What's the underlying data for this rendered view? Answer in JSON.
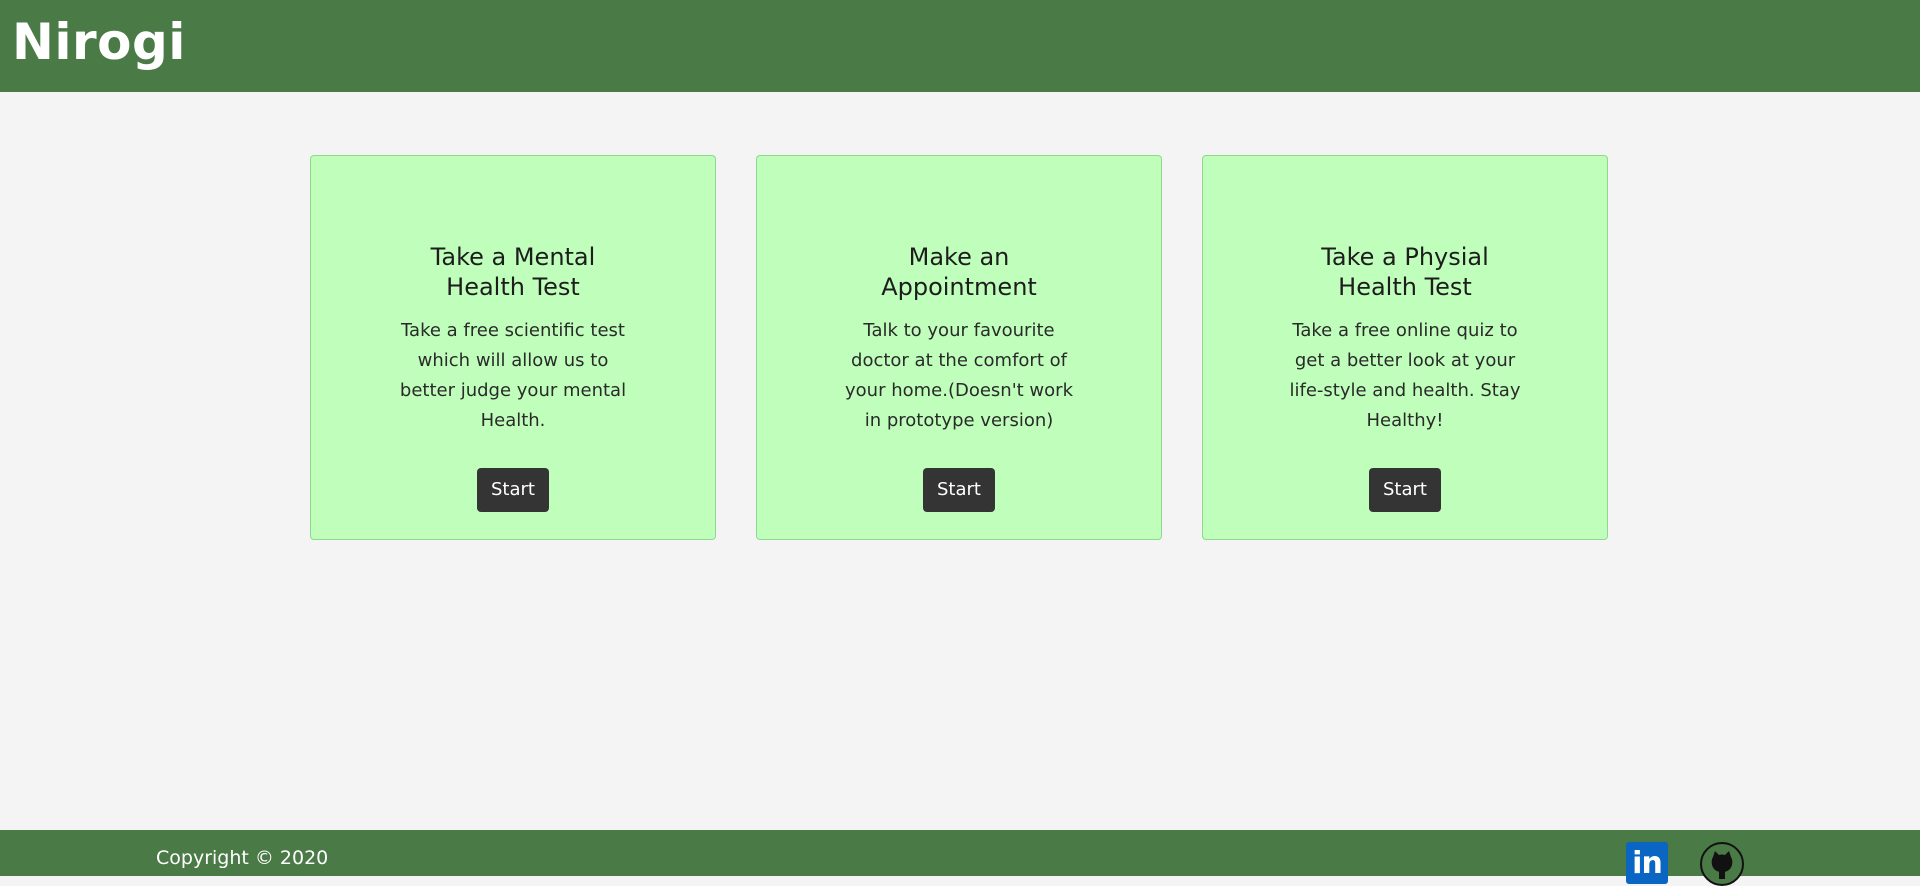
{
  "header": {
    "brand": "Nirogi"
  },
  "cards": [
    {
      "title": "Take a Mental Health Test",
      "text": "Take a free scientific test which will allow us to better judge your mental Health.",
      "button_label": "Start"
    },
    {
      "title": "Make an Appointment",
      "text": "Talk to your favourite doctor at the comfort of your home.(Doesn't work in prototype version)",
      "button_label": "Start"
    },
    {
      "title": "Take a Physial Health Test",
      "text": "Take a free online quiz to get a better look at your life-style and health. Stay Healthy!",
      "button_label": "Start"
    }
  ],
  "footer": {
    "copyright": "Copyright © 2020",
    "linkedin_icon_text": "in",
    "social_icons": [
      "linkedin-icon",
      "github-icon"
    ]
  },
  "colors": {
    "header_bg": "#4a7a46",
    "card_bg": "#c0ffbb",
    "button_bg": "#343434",
    "page_bg": "#f4f4f4"
  }
}
